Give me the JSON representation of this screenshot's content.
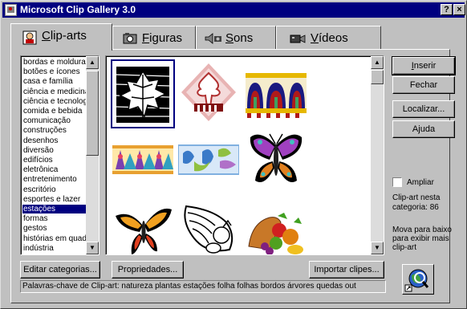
{
  "window": {
    "title": "Microsoft Clip Gallery 3.0",
    "help_button": "?",
    "close_button": "×"
  },
  "tabs": [
    {
      "label": "Clip-arts",
      "accel": "C",
      "rest": "lip-arts",
      "active": true
    },
    {
      "label": "Figuras",
      "accel": "F",
      "rest": "iguras",
      "active": false
    },
    {
      "label": "Sons",
      "accel": "S",
      "rest": "ons",
      "active": false
    },
    {
      "label": "Vídeos",
      "accel": "V",
      "rest": "ídeos",
      "active": false
    }
  ],
  "categories": {
    "items": [
      "bordas e molduras",
      "botões e ícones",
      "casa e família",
      "ciência e medicina",
      "ciência e tecnologia",
      "comida e bebida",
      "comunicação",
      "construções",
      "desenhos",
      "diversão",
      "edifícios",
      "eletrônica",
      "entretenimento",
      "escritório",
      "esportes e lazer",
      "estações",
      "formas",
      "gestos",
      "histórias em quadrinhos",
      "indústria"
    ],
    "selected": "estações"
  },
  "gallery": {
    "clips": [
      {
        "name": "leaf-clip",
        "selected": true
      },
      {
        "name": "tree-diamond-clip",
        "selected": false
      },
      {
        "name": "tulip-border-clip",
        "selected": false
      },
      {
        "name": "tulip-band-clip",
        "selected": false
      },
      {
        "name": "blue-butterfly-band-clip",
        "selected": false
      },
      {
        "name": "purple-butterfly-clip",
        "selected": false
      },
      {
        "name": "orange-butterfly-clip",
        "selected": false
      },
      {
        "name": "cornucopia-clip",
        "selected": false
      },
      {
        "name": "fruit-cornucopia-clip",
        "selected": false
      }
    ]
  },
  "buttons": {
    "insert": "Inserir",
    "close": "Fechar",
    "find": "Localizar...",
    "help": "Ajuda",
    "edit_categories": "Editar categorias...",
    "properties": "Propriedades...",
    "import_clips": "Importar clipes..."
  },
  "options": {
    "enlarge_label": "Ampliar",
    "enlarge_checked": false,
    "count_line1": "Clip-art nesta",
    "count_line2": "categoria: 86",
    "hint_line1": "Mova para baixo",
    "hint_line2": "para exibir mais",
    "hint_line3": "clip-art"
  },
  "status": {
    "keywords": "Palavras-chave de Clip-art:  natureza plantas estações folha folhas bordos árvores quedas out"
  },
  "colors": {
    "titlebar": "#000080",
    "face": "#c0c0c0",
    "selection": "#000080"
  }
}
